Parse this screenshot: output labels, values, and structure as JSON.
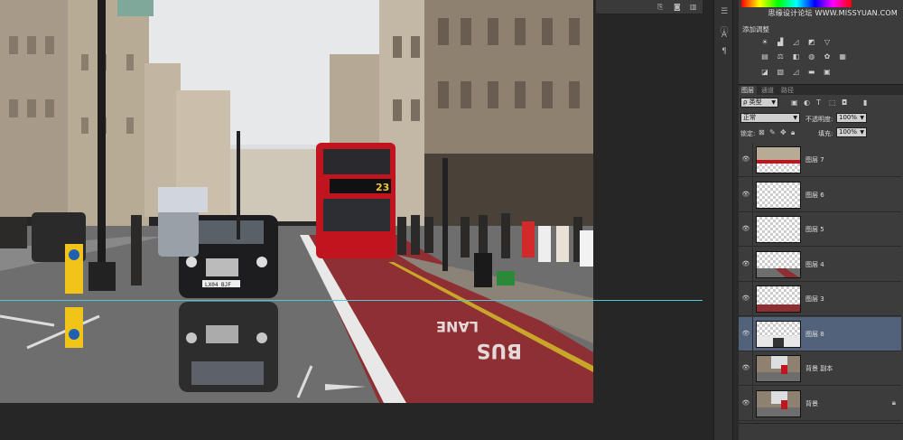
{
  "app": {
    "watermark": "思缘设计论坛 WWW.MISSYUAN.COM"
  },
  "photo": {
    "bus_route": "23",
    "bus_sign": "BUS",
    "lane_sign": "LANE",
    "taxi_plate": "LX04 BJF"
  },
  "dock": {
    "icons": [
      "history-icon",
      "info-icon",
      "character-icon",
      "paragraph-icon"
    ]
  },
  "adjustments": {
    "title": "添加调整"
  },
  "layers_panel": {
    "tabs": [
      {
        "label": "图层",
        "active": true
      },
      {
        "label": "通道",
        "active": false
      },
      {
        "label": "路径",
        "active": false
      }
    ],
    "filter_kind": "ρ 类型",
    "blend_mode": "正常",
    "opacity_label": "不透明度:",
    "opacity_value": "100%",
    "lock_label": "锁定:",
    "fill_label": "填充:",
    "fill_value": "100%",
    "layers": [
      {
        "name": "图层 7",
        "visible": true,
        "selected": false,
        "thumb": "photo-top"
      },
      {
        "name": "图层 6",
        "visible": true,
        "selected": false,
        "thumb": "transparent"
      },
      {
        "name": "图层 5",
        "visible": true,
        "selected": false,
        "thumb": "transparent"
      },
      {
        "name": "图层 4",
        "visible": true,
        "selected": false,
        "thumb": "road"
      },
      {
        "name": "图层 3",
        "visible": true,
        "selected": false,
        "thumb": "road-red"
      },
      {
        "name": "图层 8",
        "visible": true,
        "selected": true,
        "thumb": "reflection"
      },
      {
        "name": "背景 副本",
        "visible": true,
        "selected": false,
        "thumb": "photo"
      },
      {
        "name": "背景",
        "visible": true,
        "selected": false,
        "thumb": "photo",
        "locked": true
      }
    ]
  },
  "colors": {
    "selected_layer": "#52627a",
    "guide": "#4fc8d8",
    "bus_red": "#c0141e"
  }
}
